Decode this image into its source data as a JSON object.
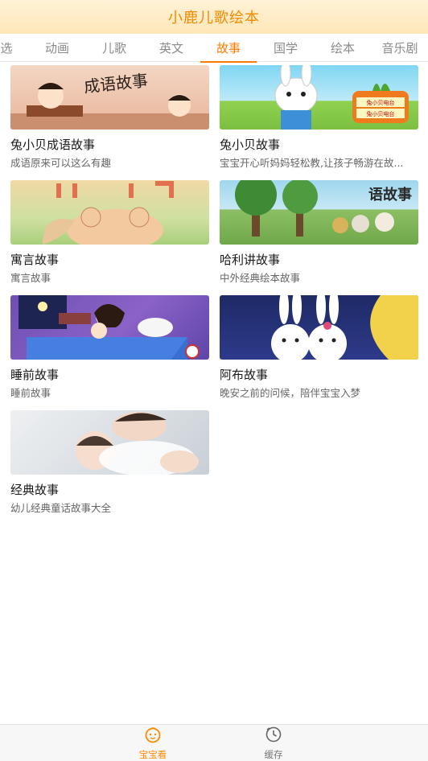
{
  "header": {
    "title": "小鹿儿歌绘本"
  },
  "tabs": [
    {
      "label": "选"
    },
    {
      "label": "动画"
    },
    {
      "label": "儿歌"
    },
    {
      "label": "英文"
    },
    {
      "label": "故事",
      "active": true
    },
    {
      "label": "国学"
    },
    {
      "label": "绘本"
    },
    {
      "label": "音乐剧"
    }
  ],
  "cards": [
    {
      "title": "兔小贝成语故事",
      "desc": "成语原来可以这么有趣",
      "image_text": "成语故事"
    },
    {
      "title": "兔小贝故事",
      "desc": "宝宝开心听妈妈轻松教,让孩子畅游在故...",
      "image_text": [
        "兔小贝电台",
        "兔小贝电台"
      ]
    },
    {
      "title": "寓言故事",
      "desc": "寓言故事",
      "image_text": ""
    },
    {
      "title": "哈利讲故事",
      "desc": "中外经典绘本故事",
      "image_text": "语故事"
    },
    {
      "title": "睡前故事",
      "desc": "睡前故事",
      "image_text": ""
    },
    {
      "title": "阿布故事",
      "desc": "晚安之前的问候，陪伴宝宝入梦",
      "image_text": ""
    },
    {
      "title": "经典故事",
      "desc": "幼儿经典童话故事大全",
      "image_text": ""
    }
  ],
  "bottom_nav": [
    {
      "label": "宝宝看",
      "icon": "baby-face-icon",
      "active": true
    },
    {
      "label": "缓存",
      "icon": "clock-icon",
      "active": false
    }
  ],
  "colors": {
    "accent": "#ff7a00",
    "header_bg": "#ffe9bf",
    "title": "#f08a00"
  }
}
